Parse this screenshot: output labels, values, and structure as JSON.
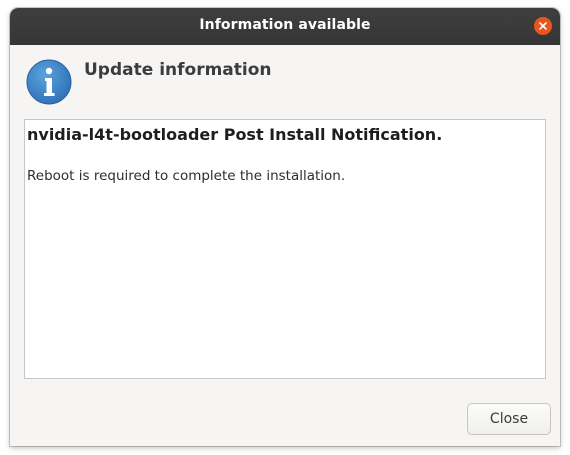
{
  "window": {
    "title": "Information available"
  },
  "header": {
    "icon": "info-icon",
    "title": "Update information"
  },
  "content": {
    "heading": "nvidia-l4t-bootloader Post Install Notification.",
    "body": "Reboot is required to complete the installation."
  },
  "buttons": {
    "close_label": "Close"
  },
  "colors": {
    "titlebar": "#383838",
    "close_accent": "#e95420",
    "info_icon": "#3b82c4"
  }
}
